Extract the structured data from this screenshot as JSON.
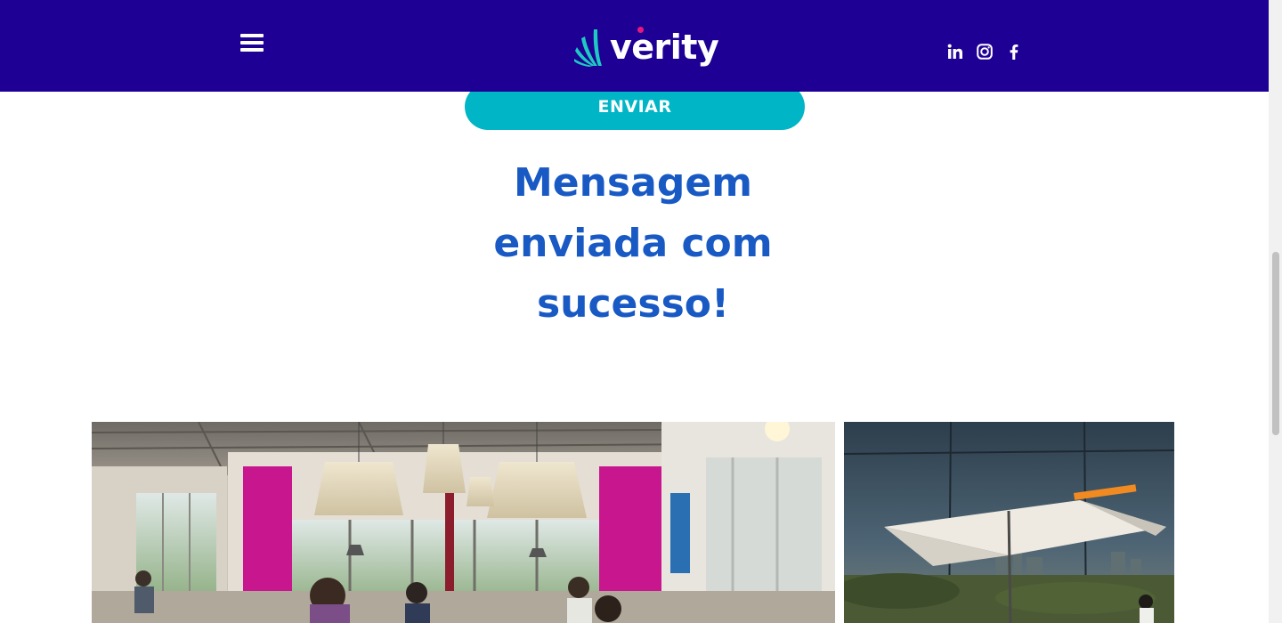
{
  "header": {
    "logo_text": "verity",
    "menu_icon": "hamburger-menu-icon",
    "social_icons": [
      "linkedin-icon",
      "instagram-icon",
      "facebook-icon"
    ],
    "colors": {
      "background": "#1f0094",
      "logo_mark": "#1ec9c4",
      "logo_dot": "#e8177e"
    }
  },
  "form": {
    "submit_label": "ENVIAR",
    "success_message": "Mensagem enviada com sucesso!",
    "colors": {
      "button": "#00b5c6",
      "message": "#1859c4"
    }
  }
}
